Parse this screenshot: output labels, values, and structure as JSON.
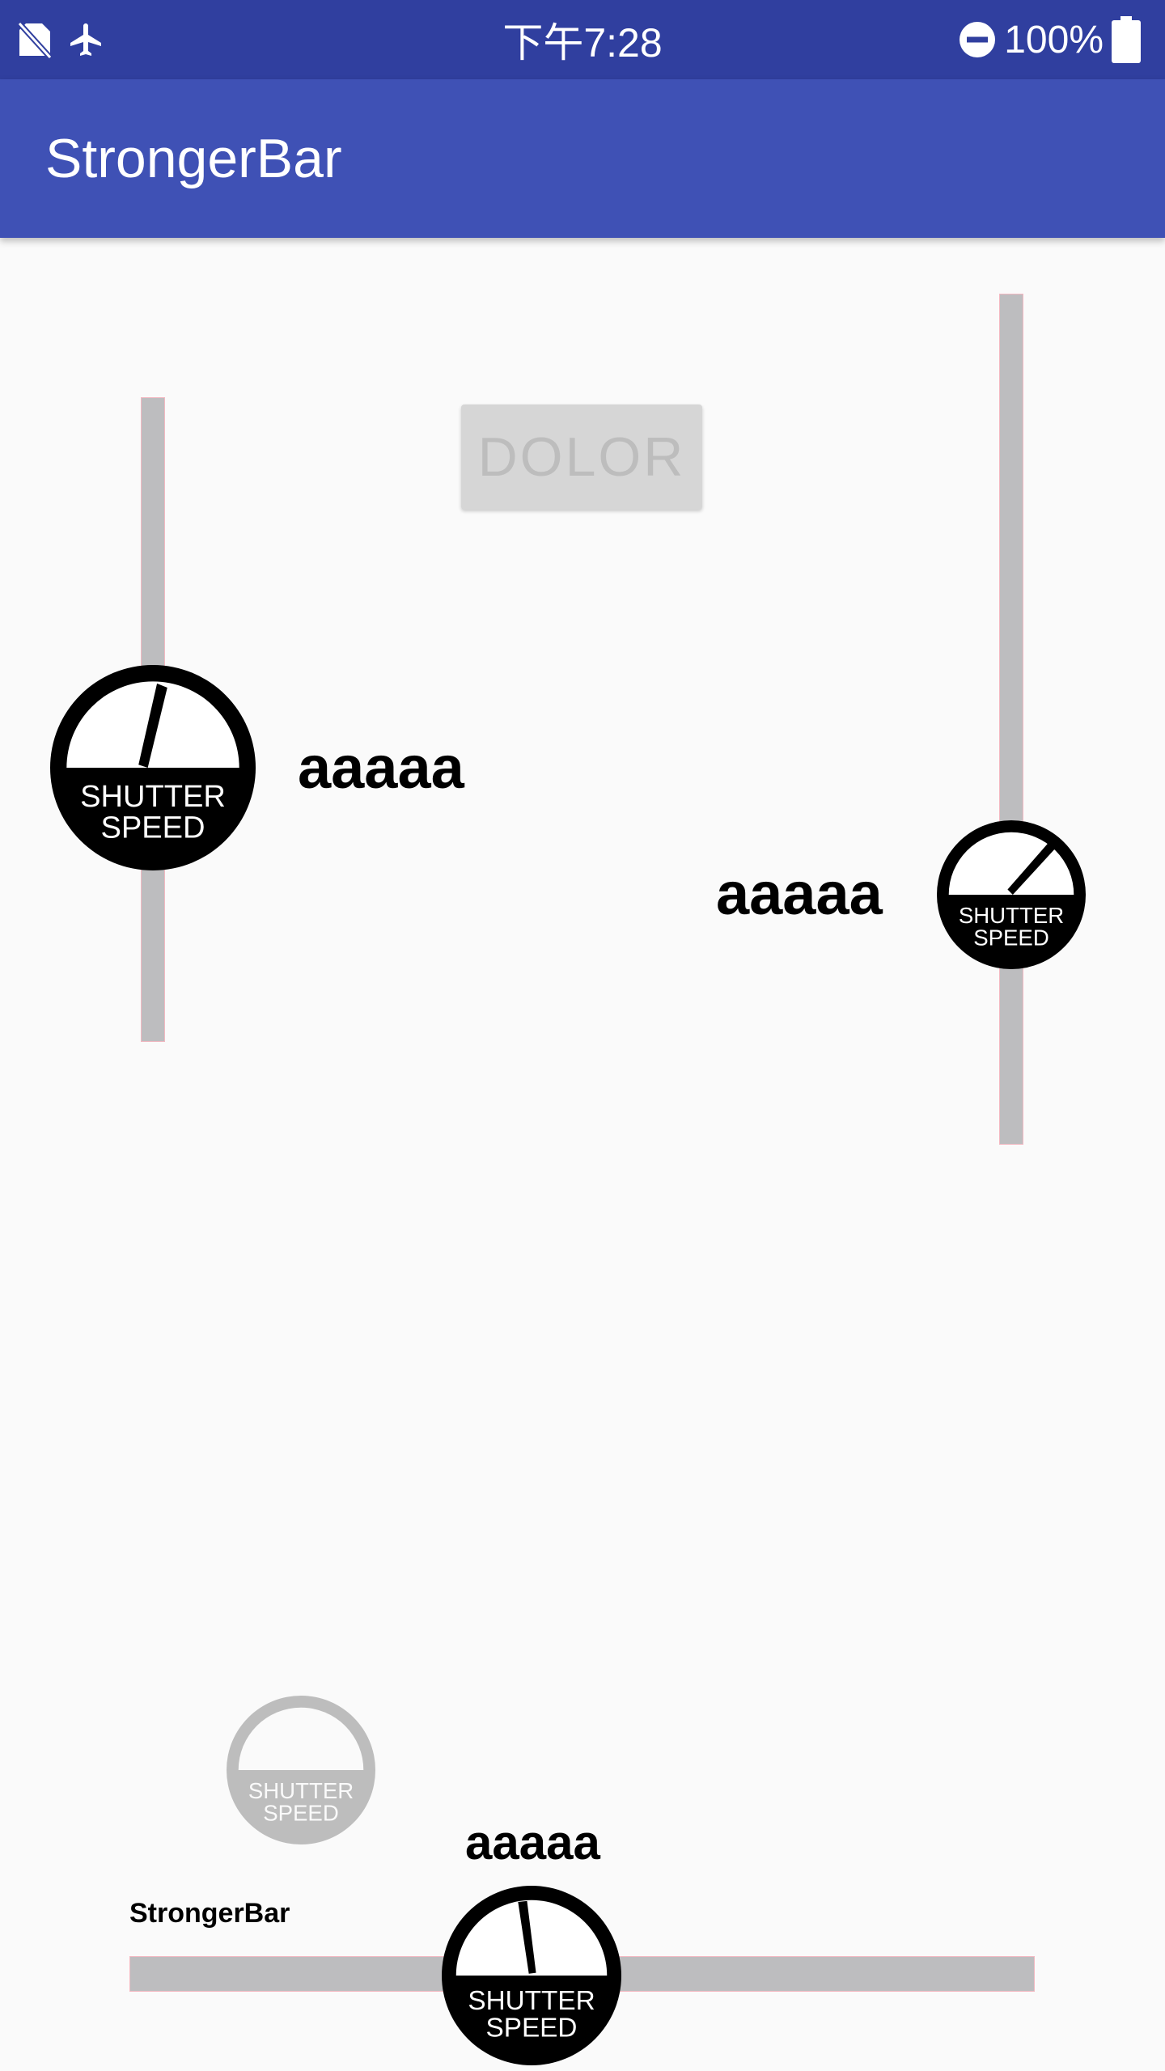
{
  "status_bar": {
    "time": "下午7:28",
    "battery": "100%",
    "icons": [
      "no-sim-icon",
      "airplane-mode-icon",
      "do-not-disturb-icon",
      "battery-full-icon"
    ]
  },
  "app_bar": {
    "title": "StrongerBar"
  },
  "button": {
    "label": "DOLOR",
    "enabled": false
  },
  "knob": {
    "line1": "SHUTTER",
    "line2": "SPEED",
    "icon": "shutter-speed-icon"
  },
  "sliders": {
    "left_vertical": {
      "label": "aaaaa",
      "value": 0.57
    },
    "right_vertical": {
      "label": "aaaaa",
      "value": 0.3
    },
    "disabled": {
      "enabled": false
    },
    "bottom_horizontal": {
      "label": "aaaaa",
      "caption": "StrongerBar",
      "value": 0.44
    }
  },
  "colors": {
    "status_bar": "#303f9f",
    "app_bar": "#3f51b5",
    "background": "#fafafa",
    "track": "#bdbdbf",
    "track_border": "#f3b9c2",
    "knob": "#000000",
    "knob_disabled": "#bdbdbd"
  }
}
